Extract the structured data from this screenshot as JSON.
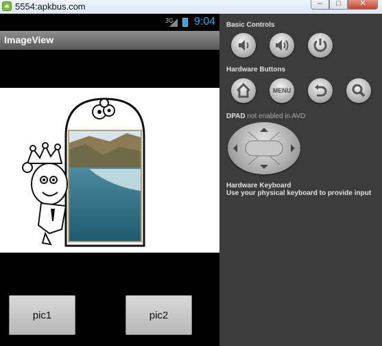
{
  "window": {
    "title": "5554:apkbus.com",
    "minimize": "–",
    "maximize": "□",
    "close": "✕"
  },
  "device": {
    "status": {
      "network": "3G",
      "time": "9:04"
    },
    "app_title": "ImageView",
    "buttons": {
      "pic1": "pic1",
      "pic2": "pic2"
    }
  },
  "controls": {
    "basic_label": "Basic Controls",
    "hardware_label": "Hardware Buttons",
    "menu_label": "MENU",
    "dpad_label": "DPAD",
    "dpad_note": "not enabled in AVD",
    "keyboard_label": "Hardware Keyboard",
    "keyboard_hint": "Use your physical keyboard to provide input"
  },
  "icons": [
    "volume-down-icon",
    "volume-up-icon",
    "power-icon",
    "home-icon",
    "back-icon",
    "search-icon",
    "dpad-icon"
  ],
  "colors": {
    "clock": "#2ea8e6",
    "panel": "#3c3c3c",
    "screen": "#000000"
  }
}
